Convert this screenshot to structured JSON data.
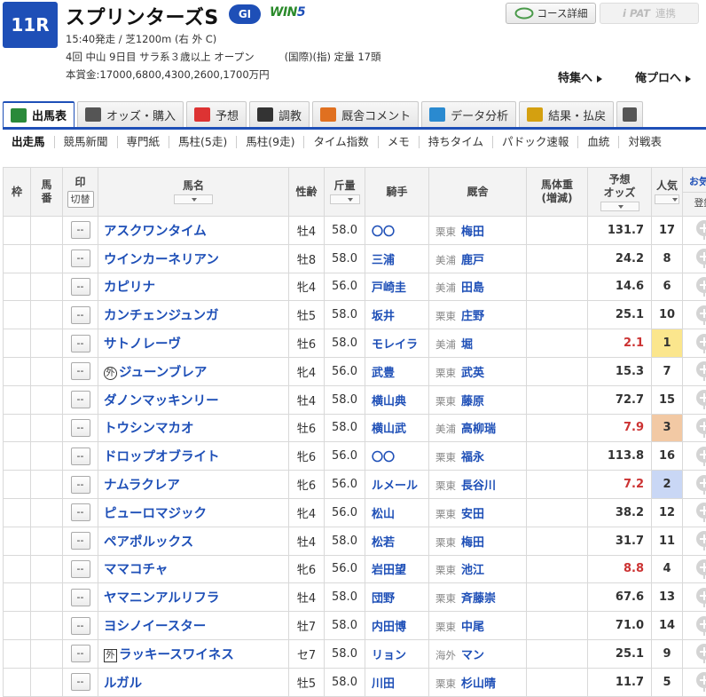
{
  "race": {
    "number": "11R",
    "name": "スプリンターズS",
    "grade": "GI",
    "win5_a": "WIN",
    "win5_b": "5",
    "info_line1": "15:40発走 / 芝1200m (右 外 C)",
    "info_line2": "4回 中山 9日目 サラ系３歳以上 オープン",
    "info_line2b": "(国際)(指) 定量 17頭",
    "prize": "本賞金:17000,6800,4300,2600,1700万円"
  },
  "buttons": {
    "course_detail": "コース詳細",
    "ipat": "i PAT",
    "ipat_link": "連携"
  },
  "links": {
    "tokushu": "特集へ",
    "orepro": "俺プロへ"
  },
  "main_tabs": [
    {
      "label": "出馬表",
      "icon": "#2a8a3a"
    },
    {
      "label": "オッズ・購入",
      "icon": "#555"
    },
    {
      "label": "予想",
      "icon": "#d33"
    },
    {
      "label": "調教",
      "icon": "#333"
    },
    {
      "label": "厩舎コメント",
      "icon": "#e07020"
    },
    {
      "label": "データ分析",
      "icon": "#2a8ad0"
    },
    {
      "label": "結果・払戻",
      "icon": "#d4a010"
    }
  ],
  "sub_tabs": [
    "出走馬",
    "競馬新聞",
    "専門紙",
    "馬柱(5走)",
    "馬柱(9走)",
    "タイム指数",
    "メモ",
    "持ちタイム",
    "パドック速報",
    "血統",
    "対戦表"
  ],
  "headers": {
    "waku": "枠",
    "umaban": "馬番",
    "mark": "印",
    "switch": "切替",
    "name": "馬名",
    "sexage": "性齢",
    "weight": "斤量",
    "jockey": "騎手",
    "stable": "厩舎",
    "bodyweight": "馬体重",
    "bodyweight_sub": "(増減)",
    "odds": "予想",
    "odds_sub": "オッズ",
    "popularity": "人気",
    "favorite": "お気に",
    "register": "登録"
  },
  "horses": [
    {
      "mark": "--",
      "gai": "",
      "name": "アスクワンタイム",
      "sexage": "牡4",
      "weight": "58.0",
      "jockey": "〇〇",
      "area": "栗東",
      "trainer": "梅田",
      "odds": "131.7",
      "pop": "17"
    },
    {
      "mark": "--",
      "gai": "",
      "name": "ウインカーネリアン",
      "sexage": "牡8",
      "weight": "58.0",
      "jockey": "三浦",
      "area": "美浦",
      "trainer": "鹿戸",
      "odds": "24.2",
      "pop": "8"
    },
    {
      "mark": "--",
      "gai": "",
      "name": "カピリナ",
      "sexage": "牝4",
      "weight": "56.0",
      "jockey": "戸崎圭",
      "area": "美浦",
      "trainer": "田島",
      "odds": "14.6",
      "pop": "6"
    },
    {
      "mark": "--",
      "gai": "",
      "name": "カンチェンジュンガ",
      "sexage": "牡5",
      "weight": "58.0",
      "jockey": "坂井",
      "area": "栗東",
      "trainer": "庄野",
      "odds": "25.1",
      "pop": "10"
    },
    {
      "mark": "--",
      "gai": "",
      "name": "サトノレーヴ",
      "sexage": "牡6",
      "weight": "58.0",
      "jockey": "モレイラ",
      "area": "美浦",
      "trainer": "堀",
      "odds": "2.1",
      "pop": "1"
    },
    {
      "mark": "--",
      "gai": "外",
      "gai_round": true,
      "name": "ジューンブレア",
      "sexage": "牝4",
      "weight": "56.0",
      "jockey": "武豊",
      "area": "栗東",
      "trainer": "武英",
      "odds": "15.3",
      "pop": "7"
    },
    {
      "mark": "--",
      "gai": "",
      "name": "ダノンマッキンリー",
      "sexage": "牡4",
      "weight": "58.0",
      "jockey": "横山典",
      "area": "栗東",
      "trainer": "藤原",
      "odds": "72.7",
      "pop": "15"
    },
    {
      "mark": "--",
      "gai": "",
      "name": "トウシンマカオ",
      "sexage": "牡6",
      "weight": "58.0",
      "jockey": "横山武",
      "area": "美浦",
      "trainer": "高柳瑞",
      "odds": "7.9",
      "pop": "3"
    },
    {
      "mark": "--",
      "gai": "",
      "name": "ドロップオブライト",
      "sexage": "牝6",
      "weight": "56.0",
      "jockey": "〇〇",
      "area": "栗東",
      "trainer": "福永",
      "odds": "113.8",
      "pop": "16"
    },
    {
      "mark": "--",
      "gai": "",
      "name": "ナムラクレア",
      "sexage": "牝6",
      "weight": "56.0",
      "jockey": "ルメール",
      "area": "栗東",
      "trainer": "長谷川",
      "odds": "7.2",
      "pop": "2"
    },
    {
      "mark": "--",
      "gai": "",
      "name": "ピューロマジック",
      "sexage": "牝4",
      "weight": "56.0",
      "jockey": "松山",
      "area": "栗東",
      "trainer": "安田",
      "odds": "38.2",
      "pop": "12"
    },
    {
      "mark": "--",
      "gai": "",
      "name": "ペアポルックス",
      "sexage": "牡4",
      "weight": "58.0",
      "jockey": "松若",
      "area": "栗東",
      "trainer": "梅田",
      "odds": "31.7",
      "pop": "11"
    },
    {
      "mark": "--",
      "gai": "",
      "name": "ママコチャ",
      "sexage": "牝6",
      "weight": "56.0",
      "jockey": "岩田望",
      "area": "栗東",
      "trainer": "池江",
      "odds": "8.8",
      "pop": "4"
    },
    {
      "mark": "--",
      "gai": "",
      "name": "ヤマニンアルリフラ",
      "sexage": "牡4",
      "weight": "58.0",
      "jockey": "団野",
      "area": "栗東",
      "trainer": "斉藤崇",
      "odds": "67.6",
      "pop": "13"
    },
    {
      "mark": "--",
      "gai": "",
      "name": "ヨシノイースター",
      "sexage": "牡7",
      "weight": "58.0",
      "jockey": "内田博",
      "area": "栗東",
      "trainer": "中尾",
      "odds": "71.0",
      "pop": "14"
    },
    {
      "mark": "--",
      "gai": "外",
      "gai_round": false,
      "name": "ラッキースワイネス",
      "sexage": "セ7",
      "weight": "58.0",
      "jockey": "リョン",
      "area": "海外",
      "trainer": "マン",
      "odds": "25.1",
      "pop": "9"
    },
    {
      "mark": "--",
      "gai": "",
      "name": "ルガル",
      "sexage": "牡5",
      "weight": "58.0",
      "jockey": "川田",
      "area": "栗東",
      "trainer": "杉山晴",
      "odds": "11.7",
      "pop": "5"
    }
  ]
}
